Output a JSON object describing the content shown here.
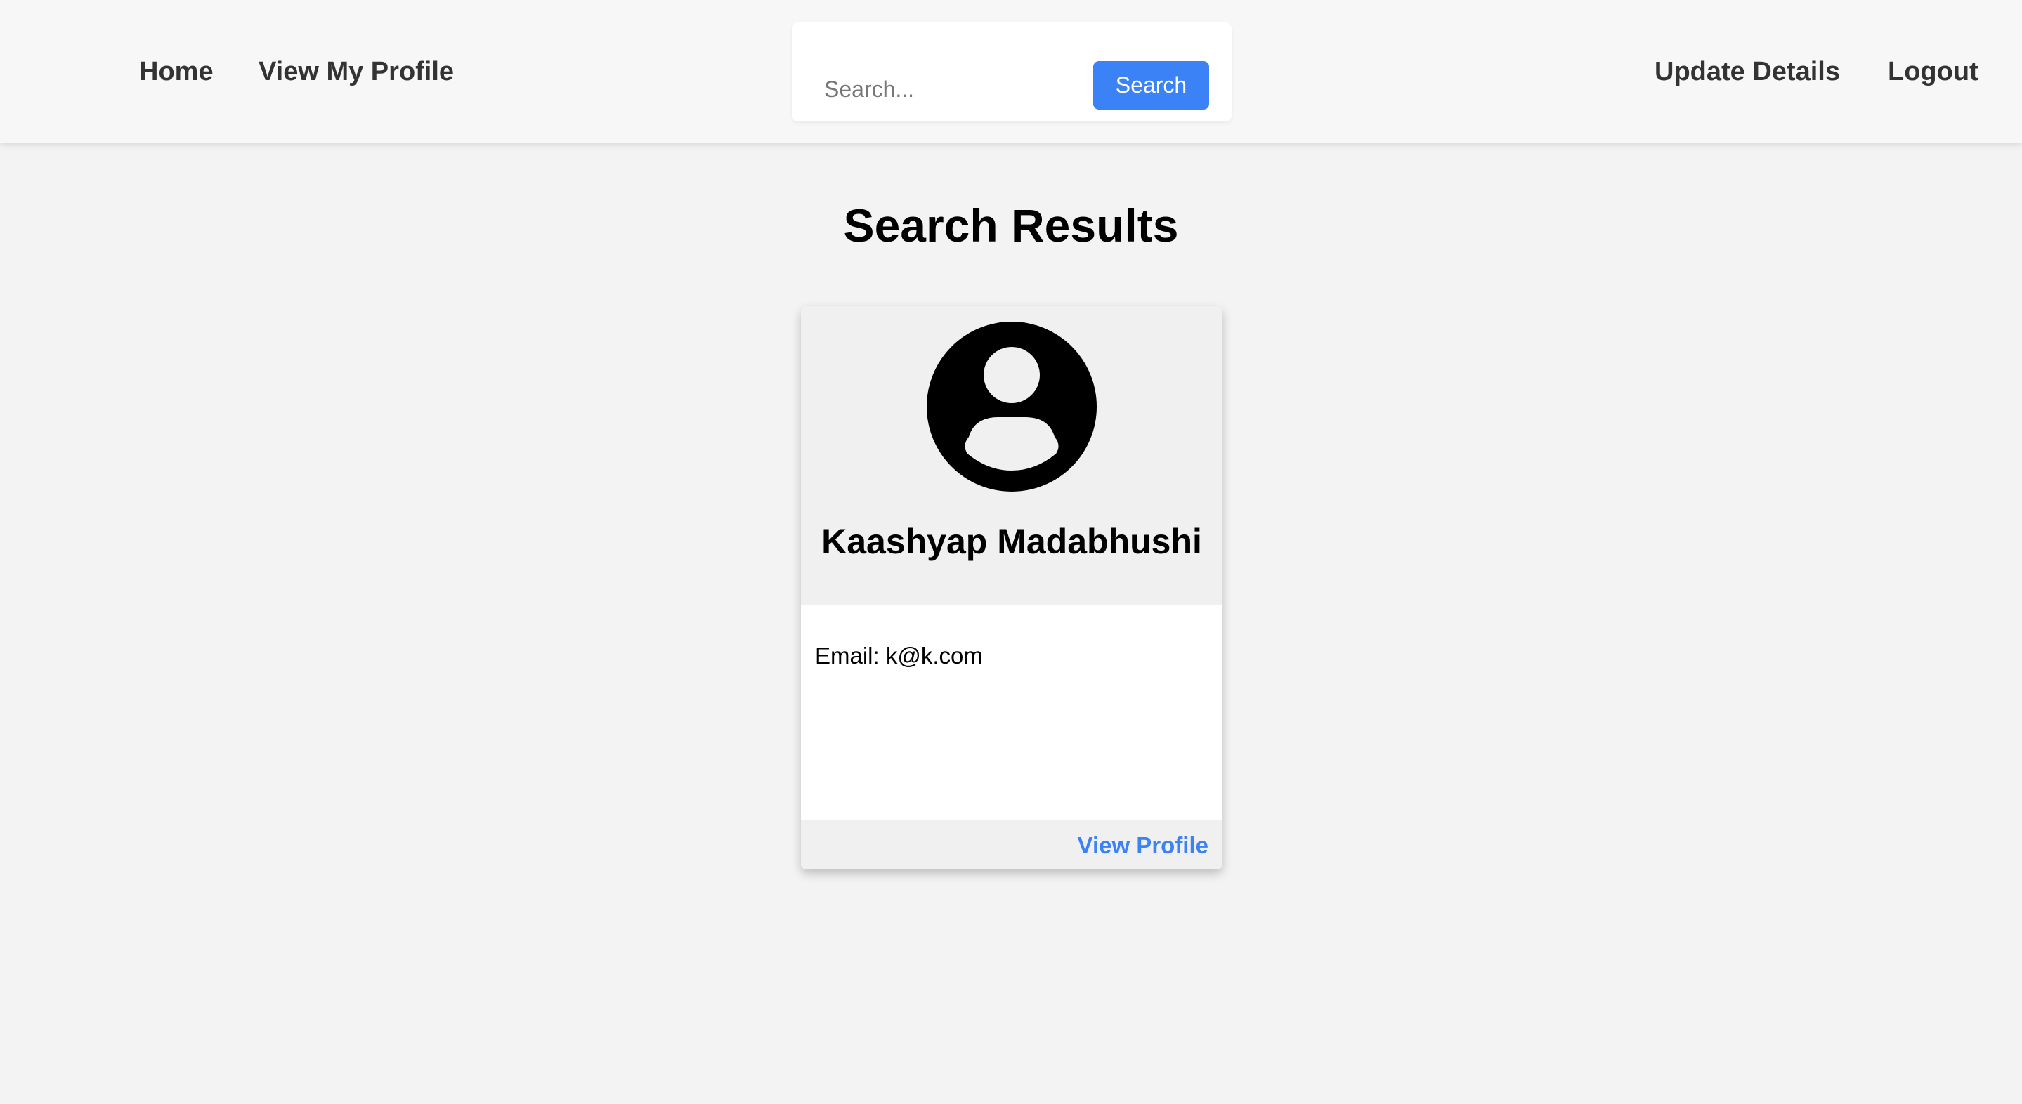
{
  "nav": {
    "home": "Home",
    "view_my_profile": "View My Profile",
    "update_details": "Update Details",
    "logout": "Logout"
  },
  "search": {
    "placeholder": "Search...",
    "value": "",
    "button_label": "Search"
  },
  "page": {
    "title": "Search Results"
  },
  "results": [
    {
      "name": "Kaashyap Madabhushi",
      "email_label": "Email:",
      "email": "k@k.com",
      "action_label": "View Profile",
      "avatar_icon": "user-circle-icon"
    }
  ],
  "colors": {
    "accent": "#3b82f6",
    "page_background": "#f3f3f3",
    "navbar_background": "#f7f7f7",
    "nav_text": "#333333",
    "card_header_background": "#f0f0f0"
  }
}
